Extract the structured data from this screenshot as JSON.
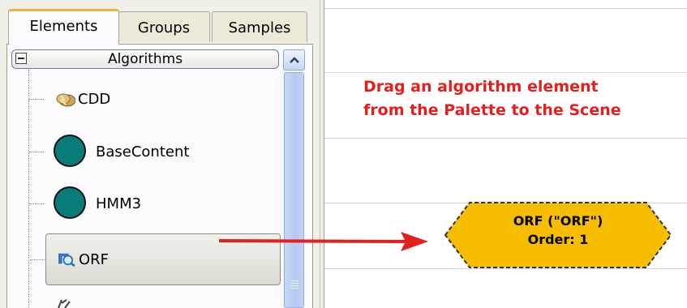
{
  "palette": {
    "tabs": [
      {
        "label": "Elements",
        "active": true
      },
      {
        "label": "Groups",
        "active": false
      },
      {
        "label": "Samples",
        "active": false
      }
    ],
    "category": {
      "label": "Algorithms",
      "expanded": true
    },
    "items": [
      {
        "label": "CDD",
        "icon": "cdd-icon"
      },
      {
        "label": "BaseContent",
        "icon": "teal-circle-icon"
      },
      {
        "label": "HMM3",
        "icon": "teal-circle-icon"
      },
      {
        "label": "ORF",
        "icon": "orf-search-icon",
        "selected": true
      }
    ]
  },
  "scene": {
    "hint_line1": "Drag an algorithm element",
    "hint_line2": "from the Palette to the Scene",
    "node": {
      "title": "ORF (\"ORF\")",
      "order": "Order: 1",
      "fill_color": "#f7be00",
      "border_color": "#333333"
    }
  },
  "colors": {
    "accent_tab": "#f5b640",
    "hint_text": "#e3201e",
    "arrow": "#e3201e",
    "circle_icon": "#0b7b79"
  }
}
